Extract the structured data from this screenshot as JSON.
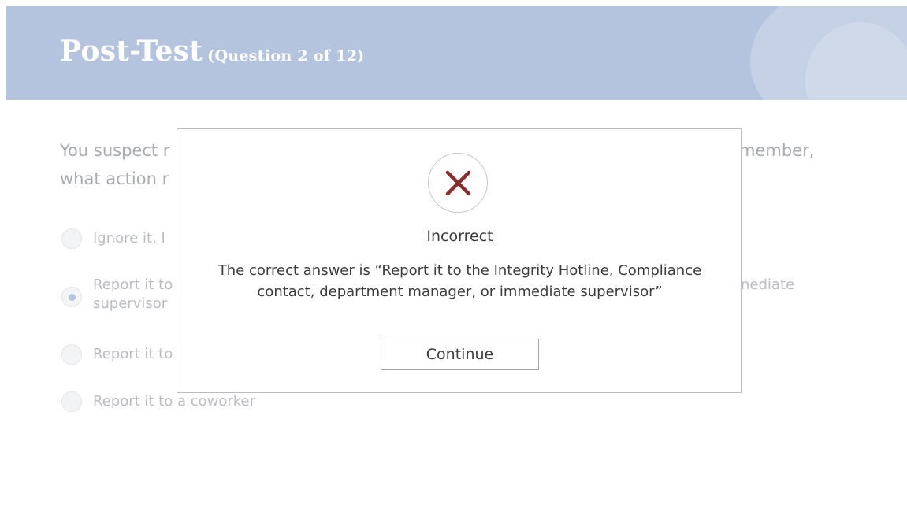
{
  "header": {
    "title": "Post-Test",
    "subtitle": "(Question 2 of 12)"
  },
  "question": {
    "line1_start": "You suspect r",
    "line1_end": "member,",
    "line2_start": "what action r"
  },
  "options": [
    {
      "text": "Ignore it, I",
      "selected": false
    },
    {
      "text": "Report it to",
      "text_line2": "supervisor",
      "text_right": "nediate",
      "selected": true
    },
    {
      "text": "Report it to",
      "selected": false
    },
    {
      "text": "Report it to a coworker",
      "selected": false
    }
  ],
  "modal": {
    "icon": "x-icon",
    "result": "Incorrect",
    "message": "The correct answer is “Report it to the Integrity Hotline, Compliance contact, department manager, or immediate supervisor”",
    "continue_label": "Continue"
  },
  "colors": {
    "header_bg": "#b5c4de",
    "x_mark": "#8b2c2c"
  }
}
